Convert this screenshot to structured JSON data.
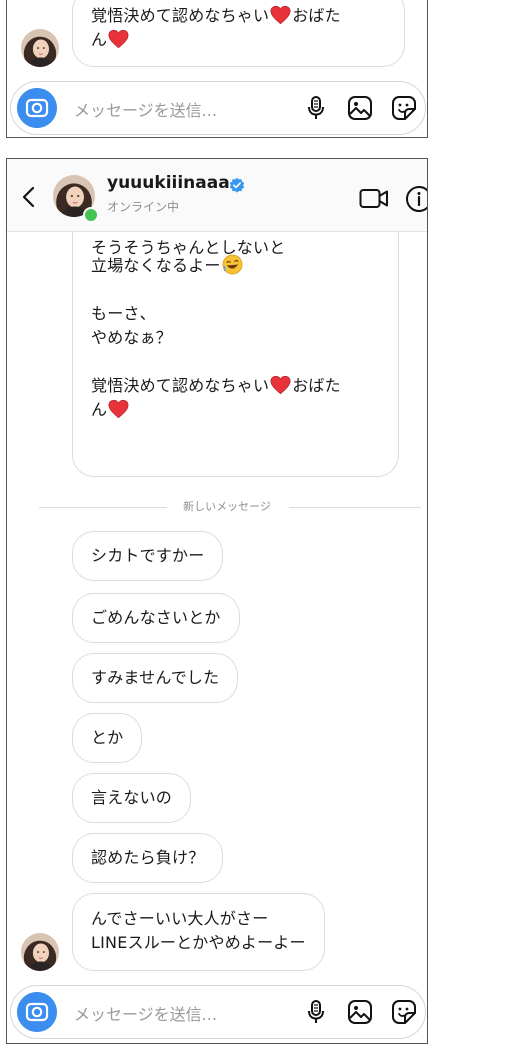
{
  "composer": {
    "placeholder": "メッセージを送信..."
  },
  "header": {
    "username": "yuuukiiinaaa",
    "status": "オンライン中"
  },
  "top_panel": {
    "partial_message": {
      "line1": "覚悟決めて認めなちゃい",
      "line1_tail": "おばた",
      "line2": "ん"
    }
  },
  "thread": {
    "incoming_long": {
      "cut_line": "そうそうちゃんとしないと",
      "line_tachiba": "立場なくなるよー",
      "line_mosa": "もーさ、",
      "line_yamena": "やめなぁ？",
      "line_kakugo": "覚悟決めて認めなちゃい",
      "line_kakugo_tail": "おばた",
      "line_n": "ん"
    },
    "new_messages_label": "新しいメッセージ",
    "messages": [
      "シカトですかー",
      "ごめんなさいとか",
      "すみませんでした",
      "とか",
      "言えないの",
      "認めたら負け？"
    ],
    "last_message": {
      "line1": "んでさーいい大人がさー",
      "line2": "LINEスルーとかやめよーよー"
    }
  },
  "colors": {
    "verified_badge": "#3897f0",
    "online_dot": "#44c553",
    "camera_button": "#3b8df0",
    "heart": "#e8333b",
    "divider": "#dbdbdb"
  },
  "icons": {
    "back": "chevron-left-icon",
    "video": "video-camera-icon",
    "info": "info-icon",
    "camera": "camera-icon",
    "microphone": "microphone-icon",
    "gallery": "gallery-icon",
    "sticker": "sticker-icon"
  }
}
